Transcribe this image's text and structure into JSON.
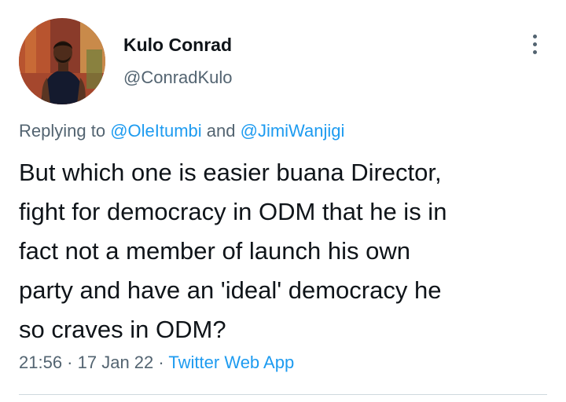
{
  "author": {
    "display_name": "Kulo Conrad",
    "handle": "@ConradKulo",
    "avatar_icon": "profile-photo"
  },
  "more_menu": {
    "icon": "more-vertical-icon"
  },
  "reply_context": {
    "prefix": "Replying to ",
    "mention_1": "@OleItumbi",
    "conjunction": " and ",
    "mention_2": "@JimiWanjigi"
  },
  "tweet": {
    "text": "But which one is easier buana Director,\nfight for democracy in ODM that he is in\nfact not a member of launch his own\nparty and have an 'ideal' democracy he\nso craves in ODM?"
  },
  "meta": {
    "time": "21:56",
    "separator": " · ",
    "date": "17 Jan 22",
    "source": "Twitter Web App"
  },
  "colors": {
    "link": "#1d9bf0",
    "secondary_text": "#536471",
    "primary_text": "#0f1419",
    "divider": "#cfd9de"
  }
}
